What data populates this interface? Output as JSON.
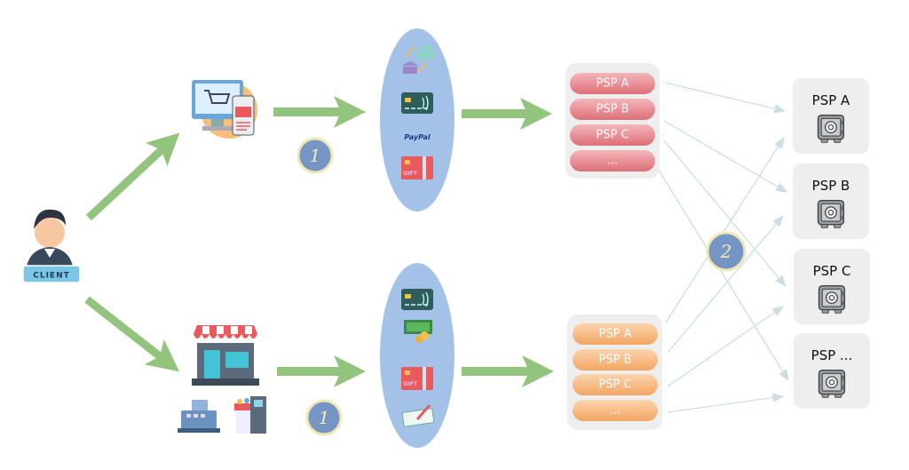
{
  "client": {
    "label": "CLIENT"
  },
  "channels": [
    {
      "name": "online",
      "icon": "computer-shopping-cart-icon"
    },
    {
      "name": "physical-store",
      "icon": "storefront-icon",
      "extra_icons": [
        "cash-register-icon",
        "self-checkout-kiosk-icon"
      ]
    }
  ],
  "payment_methods": {
    "online": [
      "bank-transfer-icon",
      "contactless-card-icon",
      "paypal-logo",
      "gift-card-icon"
    ],
    "store": [
      "contactless-card-icon",
      "cash-icon",
      "gift-card-icon",
      "cheque-icon"
    ],
    "paypal_text": "PayPal",
    "gift_text": "GIFT"
  },
  "step_badges": [
    "1",
    "1",
    "2"
  ],
  "psp_lists": {
    "online": [
      "PSP A",
      "PSP B",
      "PSP C",
      "..."
    ],
    "store": [
      "PSP A",
      "PSP B",
      "PSP C",
      "..."
    ]
  },
  "psp_vaults": [
    "PSP A",
    "PSP B",
    "PSP C",
    "PSP ..."
  ],
  "colors": {
    "arrow_green": "#93c47d",
    "ellipse_blue": "#a4c2e8",
    "online_pill": "#e88a90",
    "store_pill": "#f6b87e",
    "badge_blue": "#7596c4",
    "badge_border": "#f1e7b4",
    "connector": "#c9dfe3",
    "group_bg": "#eeeeee"
  }
}
